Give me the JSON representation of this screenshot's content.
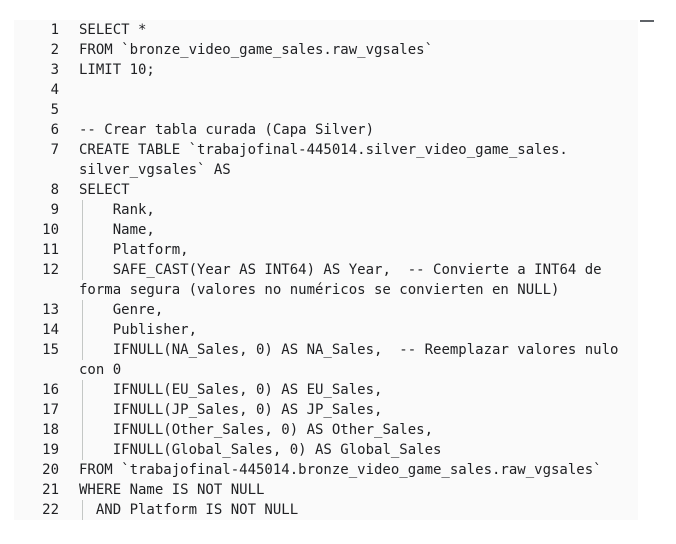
{
  "editor": {
    "lines": [
      {
        "num": "1",
        "text": "SELECT *"
      },
      {
        "num": "2",
        "text": "FROM `bronze_video_game_sales.raw_vgsales`"
      },
      {
        "num": "3",
        "text": "LIMIT 10;"
      },
      {
        "num": "4",
        "text": ""
      },
      {
        "num": "5",
        "text": ""
      },
      {
        "num": "6",
        "text": "-- Crear tabla curada (Capa Silver)"
      },
      {
        "num": "7",
        "text": "CREATE TABLE `trabajofinal-445014.silver_video_game_sales."
      },
      {
        "num": "",
        "text": "silver_vgsales` AS"
      },
      {
        "num": "8",
        "text": "SELECT"
      },
      {
        "num": "9",
        "text": "    Rank,"
      },
      {
        "num": "10",
        "text": "    Name,"
      },
      {
        "num": "11",
        "text": "    Platform,"
      },
      {
        "num": "12",
        "text": "    SAFE_CAST(Year AS INT64) AS Year,  -- Convierte a INT64 de"
      },
      {
        "num": "",
        "text": "forma segura (valores no numéricos se convierten en NULL)"
      },
      {
        "num": "13",
        "text": "    Genre,"
      },
      {
        "num": "14",
        "text": "    Publisher,"
      },
      {
        "num": "15",
        "text": "    IFNULL(NA_Sales, 0) AS NA_Sales,  -- Reemplazar valores nulo"
      },
      {
        "num": "",
        "text": "con 0"
      },
      {
        "num": "16",
        "text": "    IFNULL(EU_Sales, 0) AS EU_Sales,"
      },
      {
        "num": "17",
        "text": "    IFNULL(JP_Sales, 0) AS JP_Sales,"
      },
      {
        "num": "18",
        "text": "    IFNULL(Other_Sales, 0) AS Other_Sales,"
      },
      {
        "num": "19",
        "text": "    IFNULL(Global_Sales, 0) AS Global_Sales"
      },
      {
        "num": "20",
        "text": "FROM `trabajofinal-445014.bronze_video_game_sales.raw_vgsales`"
      },
      {
        "num": "21",
        "text": "WHERE Name IS NOT NULL"
      },
      {
        "num": "22",
        "text": "  AND Platform IS NOT NULL"
      }
    ]
  }
}
